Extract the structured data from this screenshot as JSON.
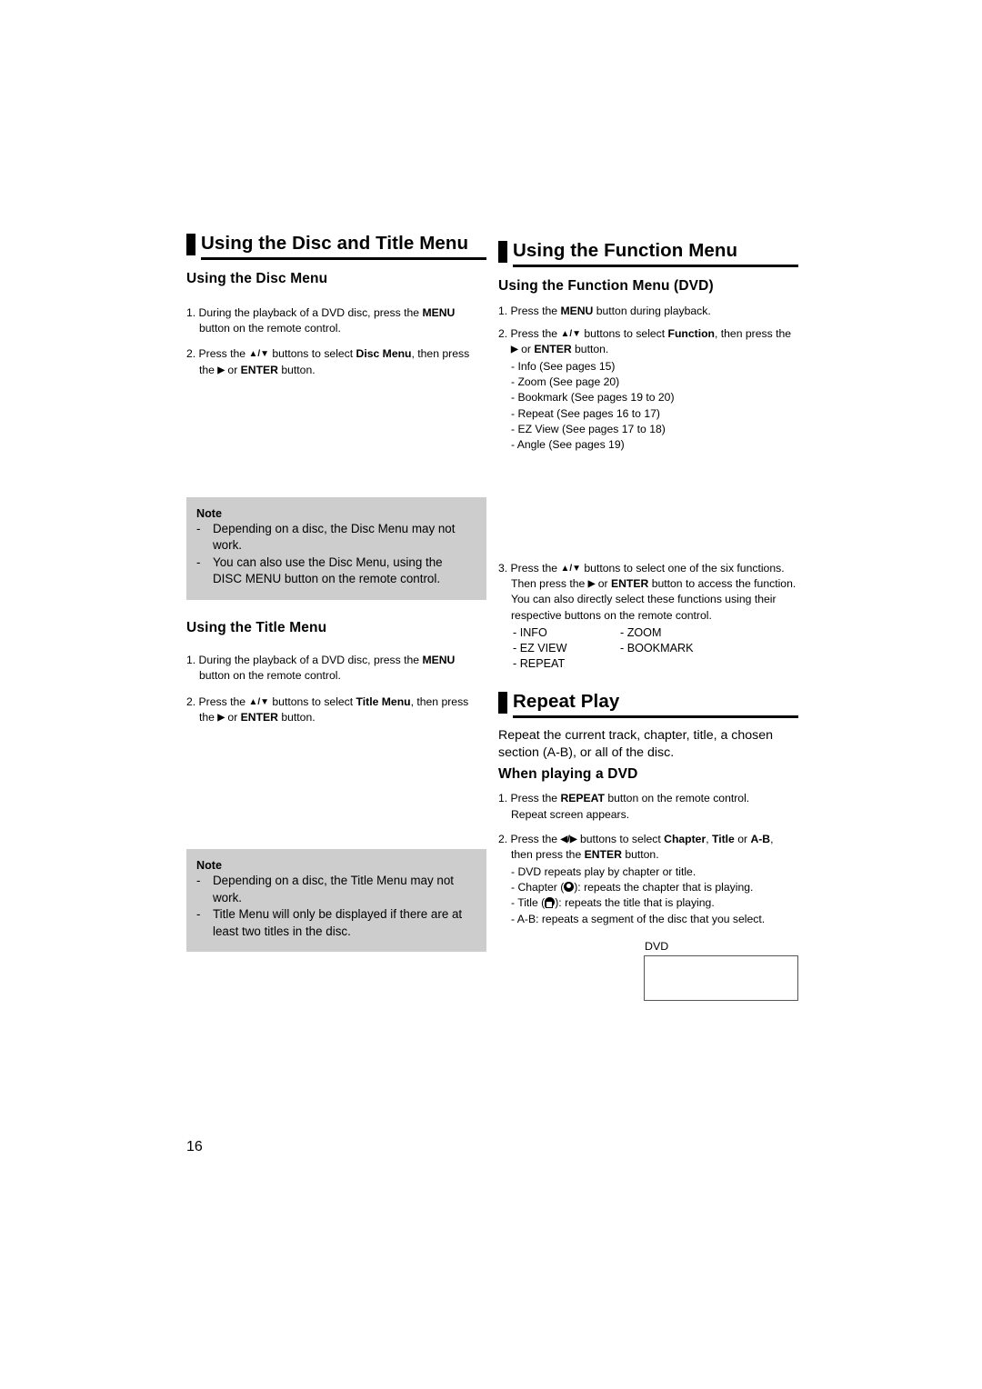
{
  "page": {
    "number": "16"
  },
  "left_column": {
    "section": {
      "title": "Using the Disc and Title Menu"
    },
    "disc_menu": {
      "heading": "Using the Disc Menu",
      "steps": [
        {
          "num": "1.",
          "parts": [
            {
              "t": "During the playback of a DVD disc, press the ",
              "b": false
            },
            {
              "t": "MENU",
              "b": true
            },
            {
              "t": " button on the remote control.",
              "b": false
            }
          ]
        },
        {
          "num": "2.",
          "parts": [
            {
              "t": "Press the ",
              "b": false
            },
            {
              "t": "▲/▼",
              "b": true
            },
            {
              "t": " buttons to select ",
              "b": false
            },
            {
              "t": "Disc Menu",
              "b": true
            },
            {
              "t": ", then press the ",
              "b": false
            },
            {
              "t": "▶",
              "b": true
            },
            {
              "t": " or ",
              "b": false
            },
            {
              "t": "ENTER",
              "b": true
            },
            {
              "t": " button.",
              "b": false
            }
          ]
        }
      ]
    },
    "disc_note": {
      "title": "Note",
      "items": [
        "Depending on a disc, the Disc Menu may not work.",
        "You can also use the Disc Menu, using the DISC MENU button on the remote control."
      ]
    },
    "title_menu": {
      "heading": "Using the Title Menu",
      "steps": [
        {
          "num": "1.",
          "parts": [
            {
              "t": "During the playback of a DVD disc, press the ",
              "b": false
            },
            {
              "t": "MENU",
              "b": true
            },
            {
              "t": " button on the remote control.",
              "b": false
            }
          ]
        },
        {
          "num": "2.",
          "parts": [
            {
              "t": "Press the ",
              "b": false
            },
            {
              "t": "▲/▼",
              "b": true
            },
            {
              "t": " buttons to select ",
              "b": false
            },
            {
              "t": "Title Menu",
              "b": true
            },
            {
              "t": ", then press the ",
              "b": false
            },
            {
              "t": "▶",
              "b": true
            },
            {
              "t": " or ",
              "b": false
            },
            {
              "t": "ENTER",
              "b": true
            },
            {
              "t": " button.",
              "b": false
            }
          ]
        }
      ]
    },
    "title_note": {
      "title": "Note",
      "items": [
        "Depending on a disc, the Title Menu may not work.",
        "Title Menu will only be displayed if there are at least two titles in the disc."
      ]
    }
  },
  "right_column": {
    "function_section": {
      "title": "Using the Function Menu",
      "heading": "Using the Function Menu (DVD)",
      "step1": {
        "num": "1.",
        "parts": [
          {
            "t": "Press the ",
            "b": false
          },
          {
            "t": "MENU",
            "b": true
          },
          {
            "t": " button during playback.",
            "b": false
          }
        ]
      },
      "step2": {
        "num": "2.",
        "parts": [
          {
            "t": "Press the ",
            "b": false
          },
          {
            "t": "▲/▼",
            "b": true
          },
          {
            "t": " buttons to select ",
            "b": false
          },
          {
            "t": "Function",
            "b": true
          },
          {
            "t": ", then press the ",
            "b": false
          }
        ],
        "cont_parts": [
          {
            "t": "▶",
            "b": true
          },
          {
            "t": " or ",
            "b": false
          },
          {
            "t": "ENTER",
            "b": true
          },
          {
            "t": " button.",
            "b": false
          }
        ],
        "sublist": [
          "- Info (See pages 15)",
          "- Zoom (See page 20)",
          "- Bookmark (See pages 19 to 20)",
          "- Repeat (See pages 16 to 17)",
          "- EZ View (See pages 17 to 18)",
          "- Angle (See pages 19)"
        ]
      },
      "step3": {
        "num": "3.",
        "parts": [
          {
            "t": "Press the ",
            "b": false
          },
          {
            "t": "▲/▼",
            "b": true
          },
          {
            "t": " buttons to select one of the six functions. Then press the ",
            "b": false
          },
          {
            "t": "▶",
            "b": true
          },
          {
            "t": " or ",
            "b": false
          },
          {
            "t": "ENTER",
            "b": true
          },
          {
            "t": " button to access the function. You can also directly select these functions using their respective buttons on the remote control.",
            "b": false
          }
        ],
        "function_list": [
          {
            "a": "- INFO",
            "b": "- ZOOM"
          },
          {
            "a": "- EZ VIEW",
            "b": "- BOOKMARK"
          },
          {
            "a": "- REPEAT",
            "b": ""
          }
        ]
      }
    },
    "repeat_section": {
      "title": "Repeat Play",
      "intro": "Repeat the current track, chapter, title, a chosen section (A-B), or all of the disc.",
      "heading": "When playing a DVD",
      "step1": {
        "num": "1.",
        "parts": [
          {
            "t": "Press the ",
            "b": false
          },
          {
            "t": "REPEAT",
            "b": true
          },
          {
            "t": " button on the remote control.",
            "b": false
          }
        ],
        "cont": "Repeat screen appears."
      },
      "step2": {
        "num": "2.",
        "parts": [
          {
            "t": "Press the ",
            "b": false
          },
          {
            "t": "◀/▶",
            "b": true
          },
          {
            "t": " buttons to select ",
            "b": false
          },
          {
            "t": "Chapter",
            "b": true
          },
          {
            "t": ", ",
            "b": false
          },
          {
            "t": "Title",
            "b": true
          },
          {
            "t": " or ",
            "b": false
          },
          {
            "t": "A-B",
            "b": true
          },
          {
            "t": ",",
            "b": false
          }
        ],
        "cont_parts": [
          {
            "t": "then press the ",
            "b": false
          },
          {
            "t": "ENTER",
            "b": true
          },
          {
            "t": " button.",
            "b": false
          }
        ],
        "bullets": [
          {
            "pre": "- DVD repeats play by chapter or title.",
            "icon": "",
            "post": ""
          },
          {
            "pre": "- Chapter (",
            "icon": "repeat-chapter-icon",
            "post": "): repeats the chapter that is playing."
          },
          {
            "pre": "- Title (",
            "icon": "repeat-title-icon",
            "post": "): repeats the title that is playing."
          },
          {
            "pre": "- A-B: repeats a segment of the disc that you select.",
            "icon": "",
            "post": ""
          }
        ]
      },
      "dvd_box": {
        "label": "DVD"
      }
    }
  },
  "colors": {
    "note_background": "#cdcdcd",
    "text": "#000000",
    "page_background": "#ffffff",
    "dvd_box_border": "#555555"
  }
}
